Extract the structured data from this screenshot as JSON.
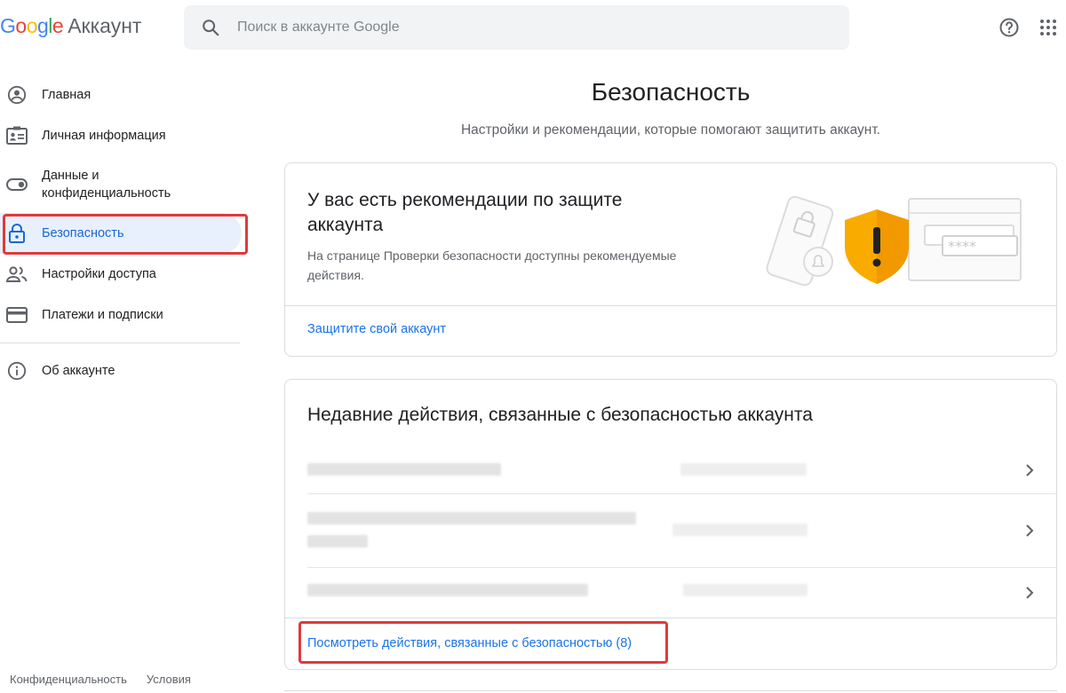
{
  "header": {
    "logo_letters": [
      {
        "ch": "G",
        "color": "#4285F4"
      },
      {
        "ch": "o",
        "color": "#EA4335"
      },
      {
        "ch": "o",
        "color": "#FBBC05"
      },
      {
        "ch": "g",
        "color": "#4285F4"
      },
      {
        "ch": "l",
        "color": "#34A853"
      },
      {
        "ch": "e",
        "color": "#EA4335"
      }
    ],
    "product": "Аккаунт",
    "search_placeholder": "Поиск в аккаунте Google"
  },
  "sidebar": {
    "items": [
      {
        "label": "Главная",
        "icon": "account-circle-icon"
      },
      {
        "label": "Личная информация",
        "icon": "id-card-icon"
      },
      {
        "label": "Данные и конфиденциальность",
        "icon": "toggle-icon"
      },
      {
        "label": "Безопасность",
        "icon": "lock-icon",
        "active": true
      },
      {
        "label": "Настройки доступа",
        "icon": "people-icon"
      },
      {
        "label": "Платежи и подписки",
        "icon": "credit-card-icon"
      }
    ],
    "about": {
      "label": "Об аккаунте",
      "icon": "info-icon"
    }
  },
  "footer": {
    "privacy": "Конфиденциальность",
    "terms": "Условия"
  },
  "main": {
    "title": "Безопасность",
    "subtitle": "Настройки и рекомендации, которые помогают защитить аккаунт.",
    "recommendation_card": {
      "title": "У вас есть рекомендации по защите аккаунта",
      "description": "На странице Проверки безопасности доступны рекомендуемые действия.",
      "link": "Защитите свой аккаунт",
      "illustration_icon": "security-warning-shield-icon"
    },
    "activity_card": {
      "title": "Недавние действия, связанные с безопасностью аккаунта",
      "view_all_link": "Посмотреть действия, связанные с безопасностью (8)"
    }
  },
  "colors": {
    "accent": "#1a73e8",
    "active_bg": "#e8f0fe",
    "highlight_outline": "#e03a3a",
    "shield": "#f9ab00"
  }
}
